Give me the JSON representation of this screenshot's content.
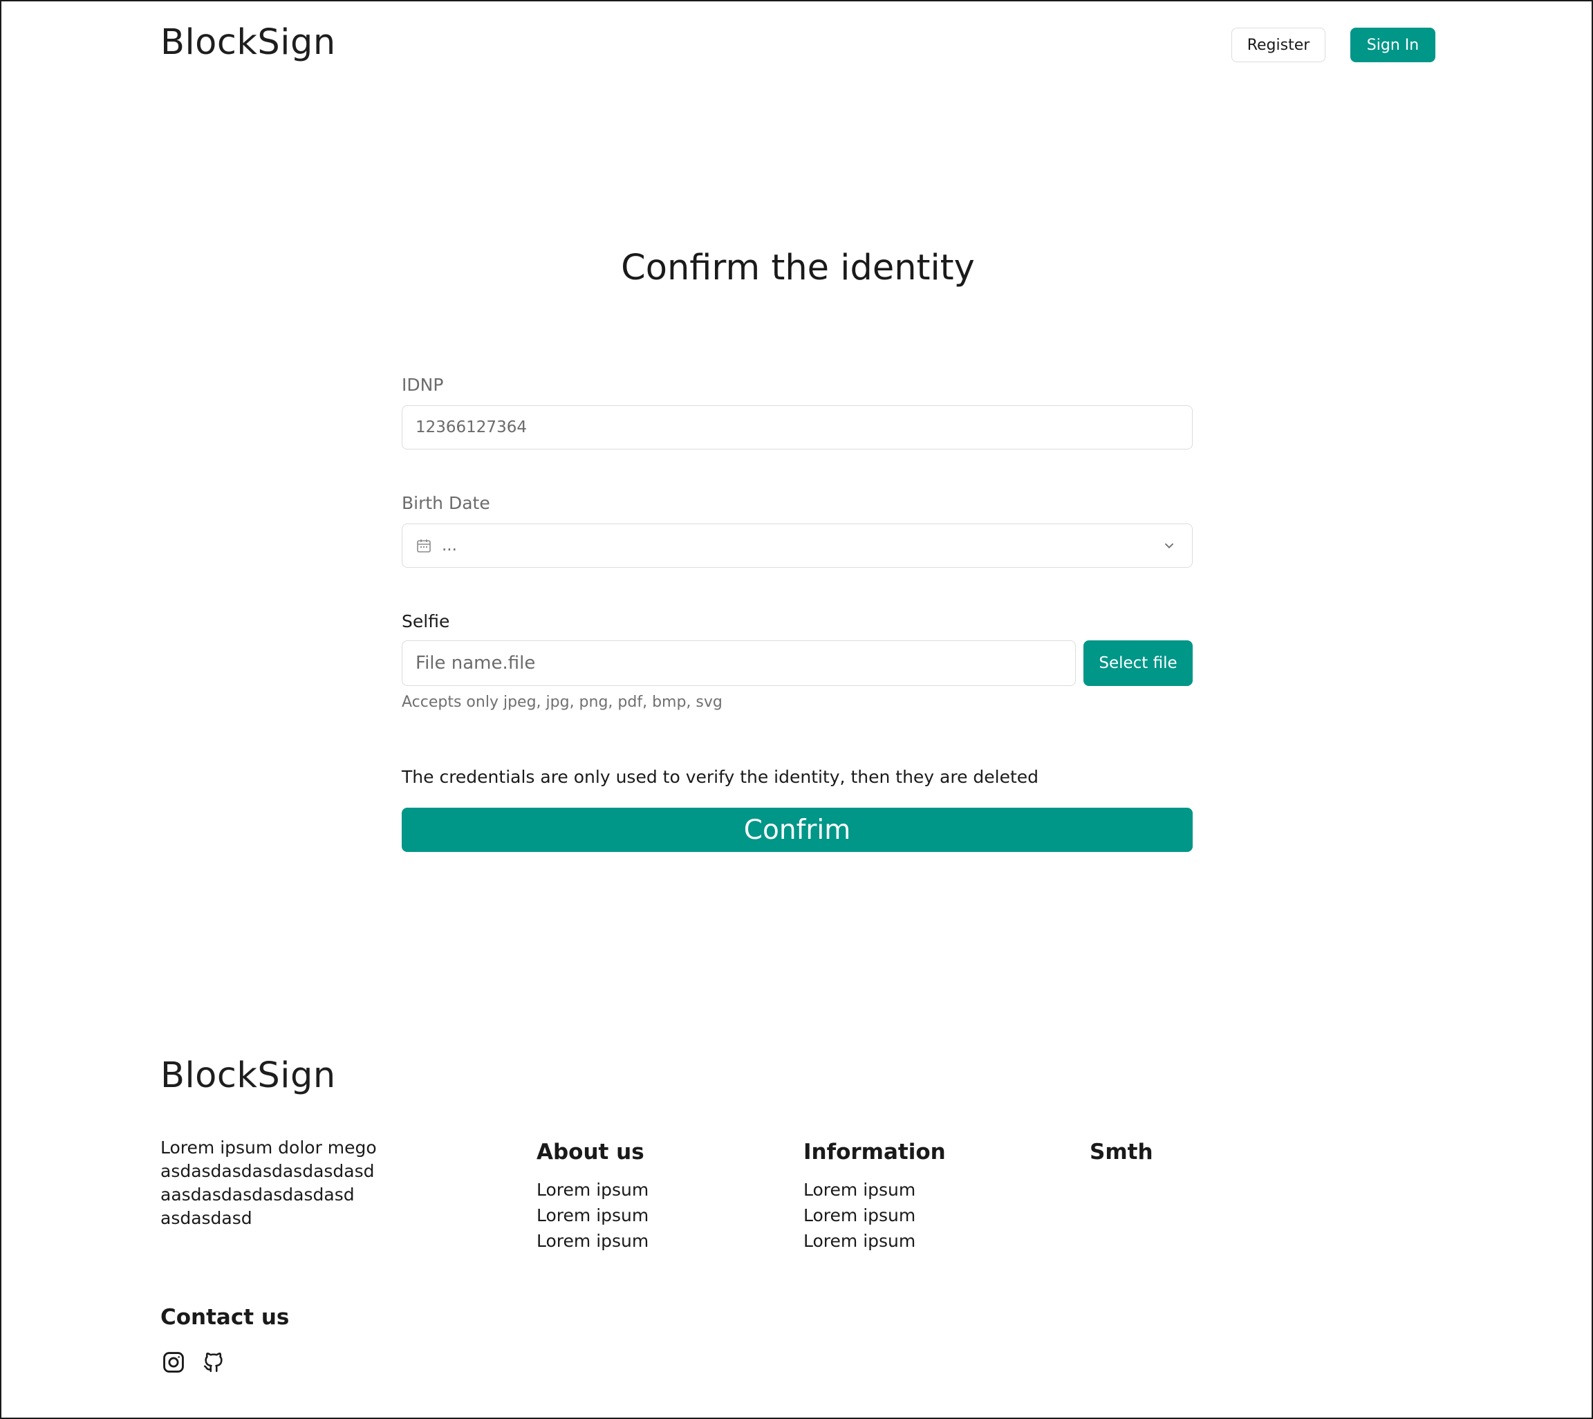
{
  "header": {
    "logo": "BlockSign",
    "register_label": "Register",
    "signin_label": "Sign In"
  },
  "main": {
    "title": "Confirm the identity",
    "idnp": {
      "label": "IDNP",
      "placeholder": "12366127364"
    },
    "birth_date": {
      "label": "Birth Date",
      "value": "..."
    },
    "selfie": {
      "label": "Selfie",
      "placeholder": "File name.file",
      "button_label": "Select file",
      "hint": "Accepts only jpeg, jpg, png, pdf, bmp, svg"
    },
    "notice": "The credentials are only used to verify the identity, then they are deleted",
    "confirm_label": "Confrim"
  },
  "footer": {
    "logo": "BlockSign",
    "description": [
      "Lorem ipsum dolor mego",
      "asdasdasdasdasdasdasd",
      "aasdasdasdasdasdasd",
      "asdasdasd"
    ],
    "columns": [
      {
        "heading": "About us",
        "links": [
          "Lorem ipsum",
          "Lorem ipsum",
          "Lorem ipsum"
        ]
      },
      {
        "heading": "Information",
        "links": [
          "Lorem ipsum",
          "Lorem ipsum",
          "Lorem ipsum"
        ]
      },
      {
        "heading": "Smth",
        "links": []
      }
    ],
    "contact_heading": "Contact us",
    "social_icons": [
      "instagram-icon",
      "github-icon"
    ]
  },
  "colors": {
    "accent": "#009688",
    "text": "#1a1a1a",
    "muted": "#6b6b6b",
    "border": "#dcdcdc"
  }
}
